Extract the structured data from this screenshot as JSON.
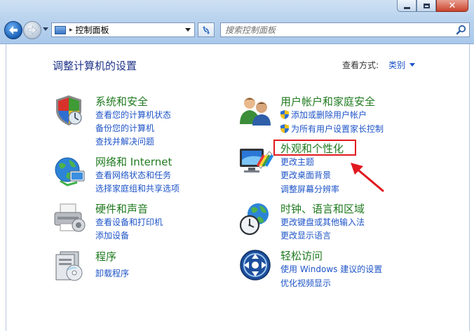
{
  "address": {
    "text": "控制面板"
  },
  "search": {
    "placeholder": "搜索控制面板"
  },
  "page": {
    "title": "调整计算机的设置",
    "view_by_label": "查看方式:",
    "view_by_value": "类别"
  },
  "categories": [
    {
      "title": "系统和安全",
      "icon": "shield-icon",
      "links": [
        "查看您的计算机状态",
        "备份您的计算机",
        "查找并解决问题"
      ]
    },
    {
      "title": "网络和 Internet",
      "icon": "network-globe-icon",
      "links": [
        "查看网络状态和任务",
        "选择家庭组和共享选项"
      ]
    },
    {
      "title": "硬件和声音",
      "icon": "printer-icon",
      "links": [
        "查看设备和打印机",
        "添加设备"
      ]
    },
    {
      "title": "程序",
      "icon": "programs-icon",
      "links": [
        "卸载程序"
      ]
    },
    {
      "title": "用户帐户和家庭安全",
      "icon": "users-icon",
      "links": [
        "添加或删除用户帐户",
        "为所有用户设置家长控制"
      ]
    },
    {
      "title": "外观和个性化",
      "icon": "monitor-palette-icon",
      "links": [
        "更改主题",
        "更改桌面背景",
        "调整屏幕分辨率"
      ]
    },
    {
      "title": "时钟、语言和区域",
      "icon": "clock-globe-icon",
      "links": [
        "更改键盘或其他输入法",
        "更改显示语言"
      ]
    },
    {
      "title": "轻松访问",
      "icon": "ease-of-access-icon",
      "links": [
        "使用 Windows 建议的设置",
        "优化视频显示"
      ]
    }
  ],
  "colors": {
    "category_title": "#1f7a1f",
    "link": "#1e54c7",
    "page_title": "#1e3287",
    "highlight": "#e0191f"
  }
}
